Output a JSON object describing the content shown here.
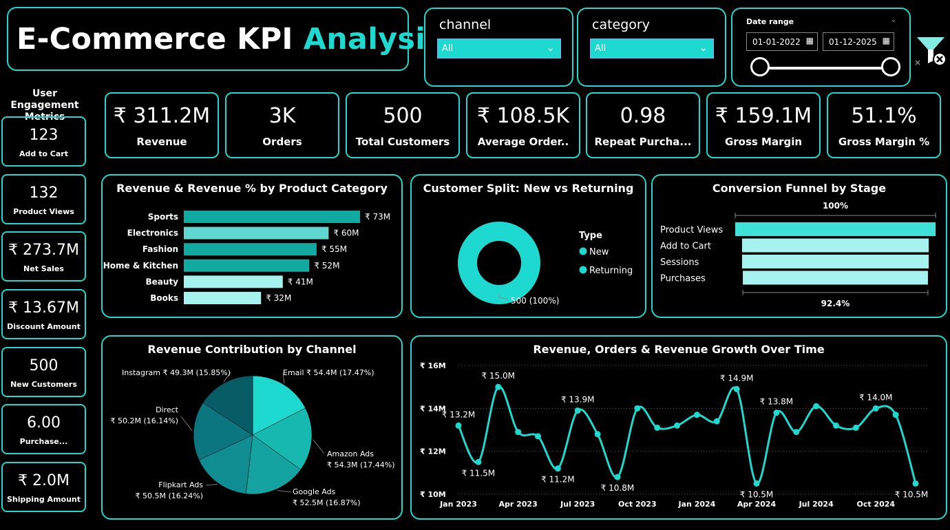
{
  "title": {
    "part1": "E-Commerce KPI ",
    "part2": "Analysis"
  },
  "filters": {
    "channel": {
      "label": "channel",
      "value": "All"
    },
    "category": {
      "label": "category",
      "value": "All"
    },
    "date_range": {
      "label": "Date range",
      "start": "01-01-2022",
      "end": "01-12-2025"
    }
  },
  "engagement": {
    "title": "User Engagement Metrics",
    "cards": [
      {
        "value": "123",
        "label": "Add to Cart"
      },
      {
        "value": "132",
        "label": "Product Views"
      },
      {
        "value": "₹ 273.7M",
        "label": "Net Sales"
      },
      {
        "value": "₹ 13.67M",
        "label": "Discount Amount"
      },
      {
        "value": "500",
        "label": "New Customers"
      },
      {
        "value": "6.00",
        "label": "Purchase..."
      },
      {
        "value": "₹ 2.0M",
        "label": "Shipping Amount"
      }
    ]
  },
  "kpis": [
    {
      "value": "₹ 311.2M",
      "label": "Revenue"
    },
    {
      "value": "3K",
      "label": "Orders"
    },
    {
      "value": "500",
      "label": "Total Customers"
    },
    {
      "value": "₹ 108.5K",
      "label": "Average Order.."
    },
    {
      "value": "0.98",
      "label": "Repeat Purcha..."
    },
    {
      "value": "₹ 159.1M",
      "label": "Gross Margin"
    },
    {
      "value": "51.1%",
      "label": "Gross Margin %"
    }
  ],
  "colors": {
    "accent": "#1ed9cf",
    "bar_dark": "#12aaa0",
    "bar_mid": "#5fd6cf",
    "bar_light": "#a6f2ee"
  },
  "chart_data": [
    {
      "type": "bar",
      "title": "Revenue & Revenue % by Product Category",
      "categories": [
        "Sports",
        "Electronics",
        "Fashion",
        "Home & Kitchen",
        "Beauty",
        "Books"
      ],
      "values": [
        73,
        60,
        55,
        52,
        41,
        32
      ],
      "labels": [
        "₹ 73M",
        "₹ 60M",
        "₹ 55M",
        "₹ 52M",
        "₹ 41M",
        "₹ 32M"
      ],
      "color_scale": [
        1.0,
        0.55,
        0.8,
        0.85,
        0.3,
        0.2
      ]
    },
    {
      "type": "pie",
      "title": "Customer Split: New vs Returning",
      "legend_title": "Type",
      "series": [
        {
          "name": "New",
          "value": 500
        },
        {
          "name": "Returning",
          "value": 0
        }
      ],
      "data_label": "500 (100%)"
    },
    {
      "type": "bar",
      "title": "Conversion Funnel by Stage",
      "categories": [
        "Product Views",
        "Add to Cart",
        "Sessions",
        "Purchases"
      ],
      "values": [
        100,
        93.2,
        93.2,
        92.4
      ],
      "top_label": "100%",
      "bottom_label": "92.4%"
    },
    {
      "type": "pie",
      "title": "Revenue Contribution by Channel",
      "slices": [
        {
          "name": "Email",
          "value": 54.4,
          "label": "Email ₹ 54.4M (17.47%)"
        },
        {
          "name": "Amazon Ads",
          "value": 54.3,
          "label": "Amazon Ads",
          "sub": "₹ 54.3M (17.44%)"
        },
        {
          "name": "Google Ads",
          "value": 52.5,
          "label": "Google Ads",
          "sub": "₹ 52.5M (16.87%)"
        },
        {
          "name": "Flipkart Ads",
          "value": 50.5,
          "label": "Flipkart Ads",
          "sub": "₹ 50.5M (16.24%)"
        },
        {
          "name": "Direct",
          "value": 50.2,
          "label": "Direct",
          "sub": "₹ 50.2M (16.14%)"
        },
        {
          "name": "Instagram",
          "value": 49.3,
          "label": "Instagram ₹ 49.3M (15.85%)"
        }
      ],
      "colors": [
        "#1ed9cf",
        "#17b8b0",
        "#14a3a1",
        "#0f8d92",
        "#0b7680",
        "#075c66"
      ]
    },
    {
      "type": "line",
      "title": "Revenue, Orders & Revenue Growth Over Time",
      "ylim": [
        10,
        16
      ],
      "yticks": [
        "₹ 10M",
        "₹ 12M",
        "₹ 14M",
        "₹ 16M"
      ],
      "xticks": [
        "Jan 2023",
        "Apr 2023",
        "Jul 2023",
        "Oct 2023",
        "Jan 2024",
        "Apr 2024",
        "Jul 2024",
        "Oct 2024"
      ],
      "values": [
        13.2,
        11.5,
        15.0,
        12.9,
        12.7,
        11.2,
        13.9,
        12.8,
        10.8,
        14.0,
        13.1,
        13.2,
        13.7,
        13.4,
        14.9,
        10.5,
        13.8,
        12.9,
        14.1,
        13.2,
        13.1,
        14.0,
        13.7,
        10.5
      ],
      "point_labels": [
        {
          "i": 0,
          "text": "₹ 13.2M"
        },
        {
          "i": 1,
          "text": "₹ 11.5M"
        },
        {
          "i": 2,
          "text": "₹ 15.0M"
        },
        {
          "i": 5,
          "text": "₹ 11.2M"
        },
        {
          "i": 6,
          "text": "₹ 13.9M"
        },
        {
          "i": 8,
          "text": "₹ 10.8M"
        },
        {
          "i": 14,
          "text": "₹ 14.9M"
        },
        {
          "i": 15,
          "text": "₹ 10.5M"
        },
        {
          "i": 16,
          "text": "₹ 13.8M"
        },
        {
          "i": 21,
          "text": "₹ 14.0M"
        },
        {
          "i": 23,
          "text": "₹ 10.5M"
        }
      ]
    }
  ]
}
